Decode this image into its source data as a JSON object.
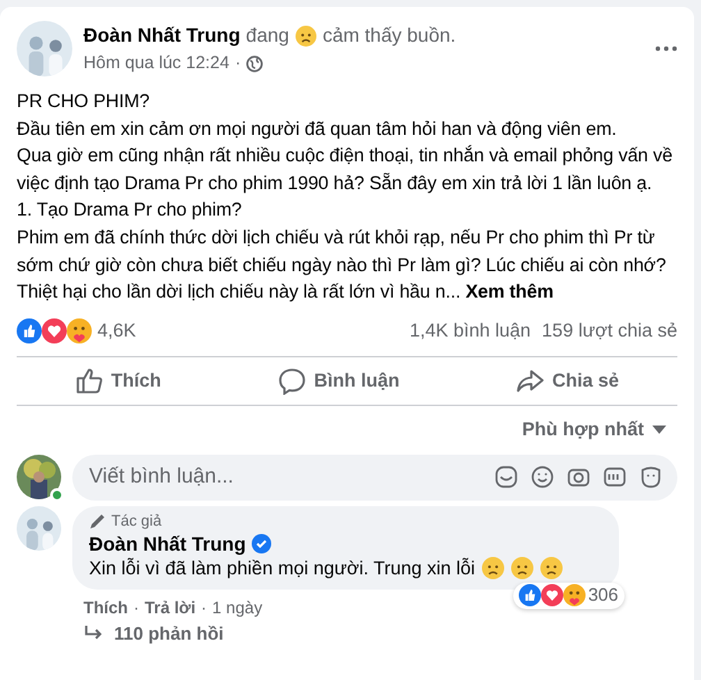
{
  "post": {
    "author": "Đoàn Nhất Trung",
    "feeling_prefix": "đang",
    "feeling": "cảm thấy buồn.",
    "time": "Hôm qua lúc 12:24",
    "separator": "·",
    "paragraphs": [
      "PR CHO PHIM?",
      "Đầu tiên em xin cảm ơn mọi người đã quan tâm hỏi han và động viên em.",
      "Qua giờ em cũng nhận rất nhiều cuộc điện thoại, tin nhắn và email phỏng vấn về việc định tạo Drama Pr cho phim 1990 hả? Sẵn đây em xin trả lời 1 lần luôn ạ.",
      "1. Tạo Drama Pr cho phim?",
      "Phim em đã chính thức dời lịch chiếu và rút khỏi rạp, nếu Pr cho phim thì Pr từ sớm chứ giờ còn chưa biết chiếu ngày nào thì Pr làm gì? Lúc chiếu ai còn nhớ? Thiệt hại cho lần dời lịch chiếu này là rất lớn vì hầu n..."
    ],
    "see_more": "Xem thêm"
  },
  "stats": {
    "reactions": "4,6K",
    "comments": "1,4K bình luận",
    "shares": "159 lượt chia sẻ"
  },
  "actions": [
    {
      "label": "Thích",
      "kind": "like"
    },
    {
      "label": "Bình luận",
      "kind": "comment"
    },
    {
      "label": "Chia sẻ",
      "kind": "share"
    }
  ],
  "sort": {
    "label": "Phù hợp nhất"
  },
  "composer": {
    "placeholder": "Viết bình luận...",
    "online": true
  },
  "comments": [
    {
      "badge": "Tác giả",
      "author": "Đoàn Nhất Trung",
      "verified": true,
      "text": "Xin lỗi vì đã làm phiền mọi người. Trung xin lỗi",
      "reactions": "306",
      "like": "Thích",
      "reply": "Trả lời",
      "separator": "·",
      "time": "1 ngày",
      "replies": "110 phản hồi"
    }
  ]
}
